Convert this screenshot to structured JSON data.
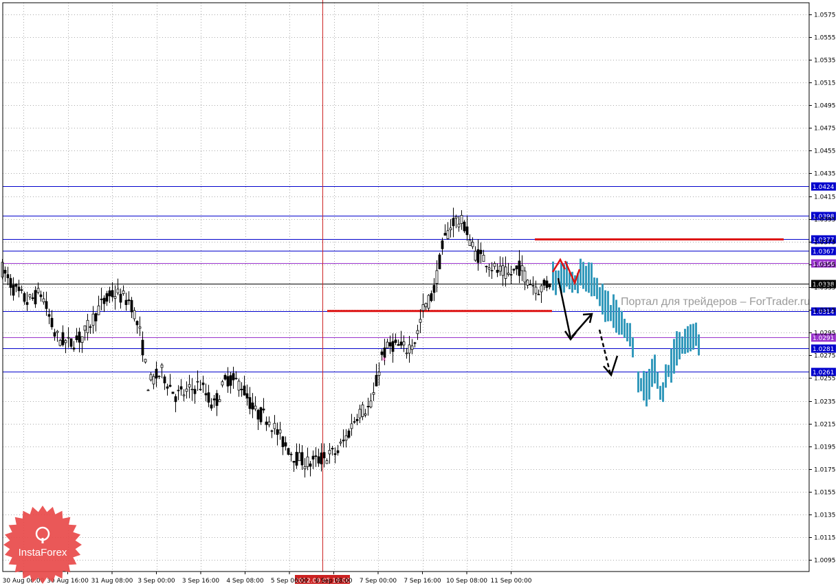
{
  "chart_data": {
    "type": "candlestick",
    "symbol_scale": "price",
    "ylim": [
      1.0085,
      1.0585
    ],
    "price_ticks": [
      "1.0575",
      "1.0555",
      "1.0535",
      "1.0515",
      "1.0495",
      "1.0475",
      "1.0455",
      "1.0435",
      "1.0415",
      "1.0395",
      "1.0375",
      "1.0355",
      "1.0335",
      "1.0315",
      "1.0295",
      "1.0275",
      "1.0255",
      "1.0235",
      "1.0215",
      "1.0195",
      "1.0175",
      "1.0155",
      "1.0135",
      "1.0115",
      "1.0095"
    ],
    "time_ticks": [
      "30 Aug 00:00",
      "30 Aug 16:00",
      "31 Aug 08:00",
      "3 Sep 00:00",
      "3 Sep 16:00",
      "4 Sep 08:00",
      "5 Sep 00:00",
      "6 Sep 08:00",
      "7 Sep 00:00",
      "7 Sep 16:00",
      "10 Sep 08:00",
      "11 Sep 00:00"
    ],
    "cursor_time_label": "2012.09.05 19:00",
    "grid": true,
    "levels": [
      {
        "label": "1.0424",
        "value": 1.0424,
        "color": "#0000cc"
      },
      {
        "label": "1.0398",
        "value": 1.0398,
        "color": "#0000cc"
      },
      {
        "label": "1.0377",
        "value": 1.0377,
        "color": "#0000cc"
      },
      {
        "label": "1.0367",
        "value": 1.0367,
        "color": "#0000cc"
      },
      {
        "label": "1.0356",
        "value": 1.0356,
        "color": "#9933cc"
      },
      {
        "label": "1.0338",
        "value": 1.0338,
        "color": "#000000"
      },
      {
        "label": "1.0314",
        "value": 1.0314,
        "color": "#0000cc"
      },
      {
        "label": "1.0291",
        "value": 1.0291,
        "color": "#9933cc"
      },
      {
        "label": "1.0281",
        "value": 1.0281,
        "color": "#0000cc"
      },
      {
        "label": "1.0261",
        "value": 1.0261,
        "color": "#0000cc"
      }
    ],
    "resistance_segments": [
      {
        "value": 1.0377,
        "color": "#dd1111"
      },
      {
        "value": 1.0314,
        "color": "#dd1111"
      }
    ],
    "watermark": "Портал для трейдеров – ForTrader.ru",
    "colors": {
      "candles": "#000000",
      "forecast": "#3399bb",
      "cursor": "#cc2222",
      "arrows_red": "#dd1111",
      "arrows_black": "#000000"
    }
  },
  "logo": {
    "text": "InstaForex",
    "color": "#e84a4a"
  }
}
